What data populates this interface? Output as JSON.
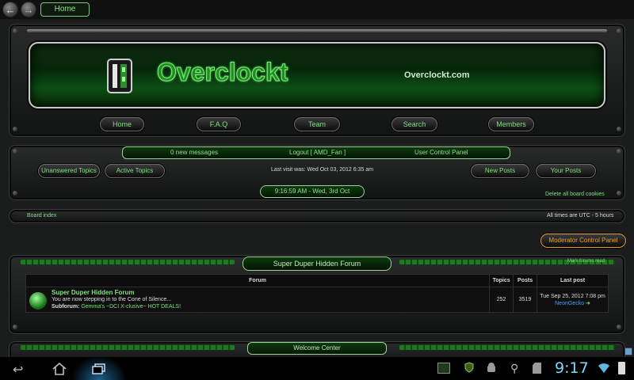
{
  "browser": {
    "back_glyph": "←",
    "forward_glyph": "→",
    "tab_label": "Home"
  },
  "header": {
    "logo_text": "Overclockt",
    "site_url": "Overclockt.com",
    "nav": [
      "Home",
      "F.A.Q",
      "Team",
      "Search",
      "Members"
    ]
  },
  "userbar": {
    "messages": "0 new messages",
    "logout": "Logout [ AMD_Fan ]",
    "ucp": "User Control Panel",
    "unanswered": "Unanswered Topics",
    "active": "Active Topics",
    "last_visit": "Last visit was: Wed Oct 03, 2012 6:35 am",
    "new_posts": "New Posts",
    "your_posts": "Your Posts",
    "datetime": "9:16:59 AM - Wed, 3rd Oct",
    "delete_cookies": "Delete all board cookies"
  },
  "breadcrumb": {
    "board_index": "Board index",
    "timezone": "All times are UTC - 5 hours"
  },
  "moderator_panel": "Moderator Control Panel",
  "category": {
    "title": "Super Duper Hidden Forum",
    "mark_read": "Mark forums read",
    "columns": [
      "Forum",
      "Topics",
      "Posts",
      "Last post"
    ],
    "row": {
      "name": "Super Duper Hidden Forum",
      "description": "You are now stepping in to the Cone of Silence...",
      "subforum_label": "Subforum:",
      "subforum_name": "Gemma's ~DCI X-clusive~ HOT DEALS!",
      "topics": "252",
      "posts": "3519",
      "last_post_date": "Tue Sep 25, 2012 7:08 pm",
      "last_post_user": "NeonGecko"
    }
  },
  "next_category": "Welcome Center",
  "system_bar": {
    "time": "9:17",
    "accent_color": "#7fd7ff"
  },
  "colors": {
    "accent_green": "#7fe07f",
    "moderator_orange": "#e0a030"
  }
}
